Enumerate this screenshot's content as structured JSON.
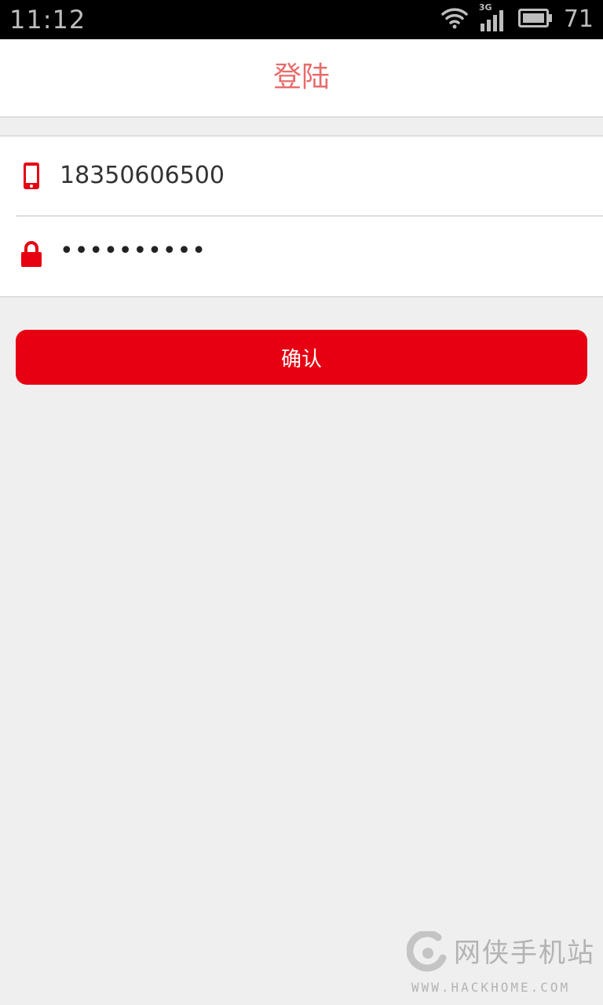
{
  "status_bar": {
    "time": "11:12",
    "network": "3G",
    "battery_percent": "71",
    "icons": [
      "wifi-icon",
      "signal-icon",
      "battery-icon"
    ]
  },
  "header": {
    "title": "登陆"
  },
  "form": {
    "phone_value": "18350606500",
    "password_value": "••••••••••",
    "phone_icon": "phone-icon",
    "lock_icon": "lock-icon"
  },
  "actions": {
    "confirm_label": "确认"
  },
  "watermark": {
    "site_name": "网侠手机站",
    "url": "WWW.HACKHOME.COM"
  },
  "colors": {
    "accent": "#e60012",
    "title": "#e76b6b",
    "background": "#efefef"
  }
}
